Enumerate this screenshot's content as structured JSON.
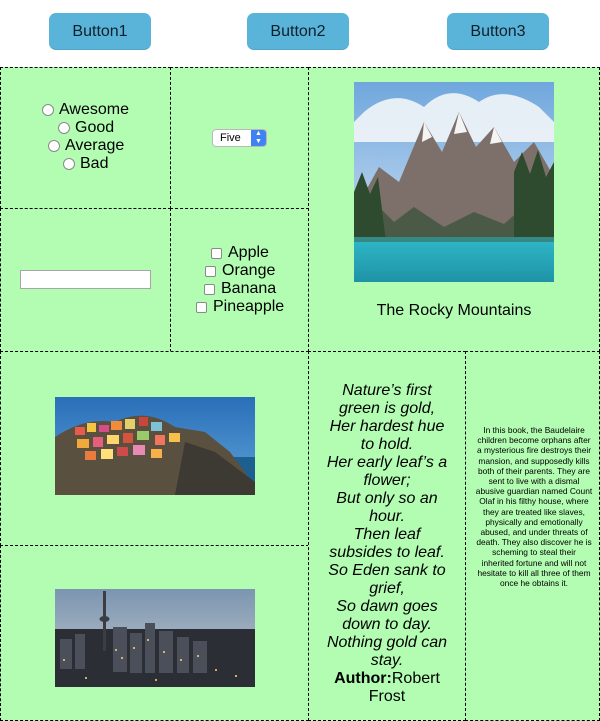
{
  "buttons": [
    "Button1",
    "Button2",
    "Button3"
  ],
  "ratings": [
    "Awesome",
    "Good",
    "Average",
    "Bad"
  ],
  "select": {
    "selected": "Five"
  },
  "text_input": {
    "value": ""
  },
  "fruits": [
    "Apple",
    "Orange",
    "Banana",
    "Pineapple"
  ],
  "mountain_caption": "The Rocky Mountains",
  "poem": {
    "lines": [
      "Nature’s first",
      "green is gold,",
      "Her hardest hue",
      "to hold.",
      "Her early leaf’s a",
      "flower;",
      "But only so an",
      "hour.",
      "Then leaf",
      "subsides to leaf.",
      "So Eden sank to",
      "grief,",
      "So dawn goes",
      "down to day.",
      "Nothing gold can",
      "stay."
    ],
    "author_label": "Author:",
    "author_first": "Robert",
    "author_last": "Frost"
  },
  "book_text": "In this book, the Baudelaire children become orphans after a mysterious fire destroys their mansion, and supposedly kills both of their parents. They are sent to live with a dismal abusive guardian named Count Olaf in his filthy house, where they are treated like slaves, physically and emotionally abused, and under threats of death. They also discover he is scheming to steal their inherited fortune and will not hesitate to kill all three of them once he obtains it.",
  "colors": {
    "cell_bg": "#b3fdb3",
    "button_bg": "#5ab3d8"
  }
}
